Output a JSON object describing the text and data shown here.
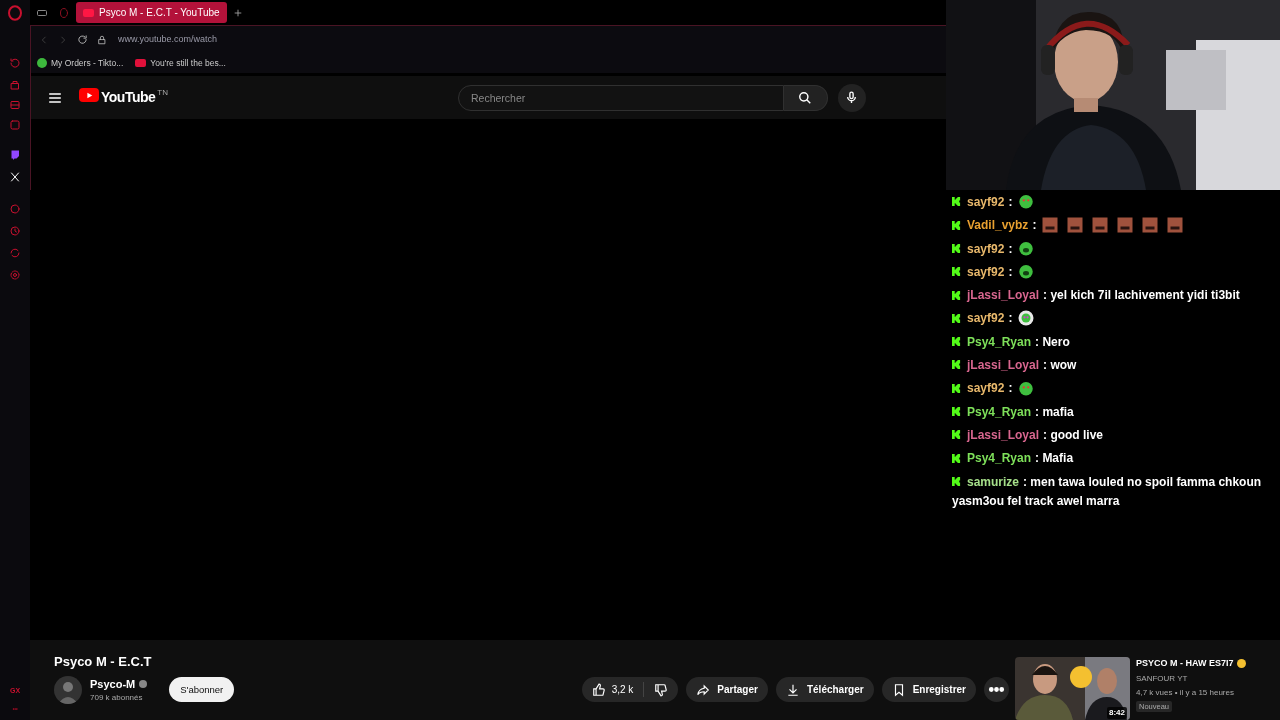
{
  "browser": {
    "tabs": [
      {
        "title": "Psyco M - E.C.T - YouTube",
        "selected": true
      }
    ],
    "url": "www.youtube.com/watch",
    "bookmarks": [
      {
        "label": "My Orders - Tikto...",
        "kind": "site"
      },
      {
        "label": "You're still the bes...",
        "kind": "youtube"
      }
    ]
  },
  "sidebar": {
    "label": "GX"
  },
  "youtube": {
    "logo": "YouTube",
    "logo_mark": "TN",
    "search": {
      "placeholder": "Rechercher"
    }
  },
  "video": {
    "title": "Psyco M - E.C.T",
    "channel": "Psyco-M",
    "verified": true,
    "subscribers": "709 k abonnés",
    "subscribe": "S'abonner",
    "likes": "3,2 k",
    "actions": [
      {
        "label": "Partager",
        "kind": "share"
      },
      {
        "label": "Télécharger",
        "kind": "download"
      },
      {
        "label": "Enregistrer",
        "kind": "save"
      }
    ]
  },
  "recommended": {
    "title": "PSYCO M - HAW ES7I7",
    "channel": "SANFOUR YT",
    "meta": "4,7 k vues • il y a 15 heures",
    "badge": "Nouveau",
    "duration": "8:42"
  },
  "chat": [
    {
      "user": "sayf92",
      "color": "#e8b86b",
      "text": ":",
      "emotes": [
        {
          "kind": "blob"
        }
      ]
    },
    {
      "user": "Vadil_vybz",
      "color": "#e8a030",
      "text": ":",
      "emotes": [
        {
          "kind": "face"
        },
        {
          "kind": "face"
        },
        {
          "kind": "face"
        },
        {
          "kind": "face"
        },
        {
          "kind": "face"
        },
        {
          "kind": "face"
        }
      ]
    },
    {
      "user": "sayf92",
      "color": "#e8b86b",
      "text": ":",
      "emotes": [
        {
          "kind": "cry"
        }
      ]
    },
    {
      "user": "sayf92",
      "color": "#e8b86b",
      "text": ":",
      "emotes": [
        {
          "kind": "cry"
        }
      ]
    },
    {
      "user": "jLassi_Loyal",
      "color": "#d9668f",
      "text": ": yel kich 7il lachivement yidi ti3bit"
    },
    {
      "user": "sayf92",
      "color": "#e8b86b",
      "text": ":",
      "emotes": [
        {
          "kind": "clown"
        }
      ]
    },
    {
      "user": "Psy4_Ryan",
      "color": "#7ee05a",
      "text": ": Nero"
    },
    {
      "user": "jLassi_Loyal",
      "color": "#d9668f",
      "text": ": wow"
    },
    {
      "user": "sayf92",
      "color": "#e8b86b",
      "text": ":",
      "emotes": [
        {
          "kind": "blob"
        }
      ]
    },
    {
      "user": "Psy4_Ryan",
      "color": "#7ee05a",
      "text": ": mafia"
    },
    {
      "user": "jLassi_Loyal",
      "color": "#d9668f",
      "text": ": good live"
    },
    {
      "user": "Psy4_Ryan",
      "color": "#7ee05a",
      "text": ": Mafia"
    },
    {
      "user": "samurize",
      "color": "#a6e08a",
      "text": ": men tawa louled no spoil famma chkoun yasm3ou fel track awel marra"
    }
  ]
}
